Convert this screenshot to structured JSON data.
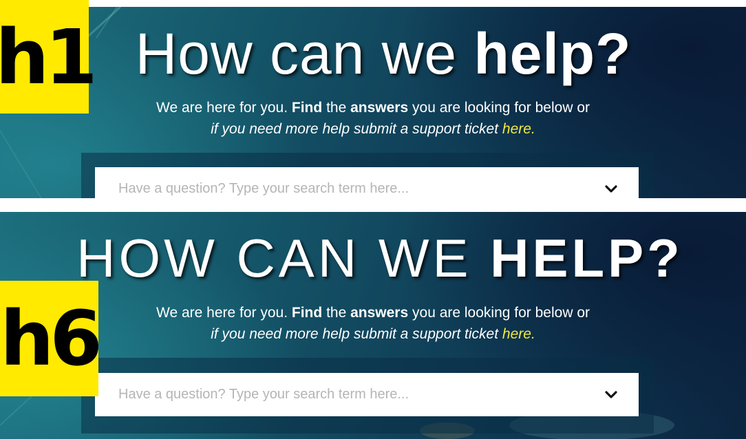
{
  "top_panel": {
    "heading_level_tag": "h1",
    "headline_light": "How can we",
    "headline_bold": "help?",
    "subtitle": {
      "part1": "We are here for you.",
      "find": "Find",
      "the": "the",
      "answers": "answers",
      "rest": "you are looking for below or",
      "line2": "if you need more help submit a support ticket",
      "link": "here."
    },
    "search": {
      "placeholder": "Have a question? Type your search term here..."
    }
  },
  "bottom_panel": {
    "heading_level_tag": "h6",
    "headline_light": "HOW CAN WE",
    "headline_bold": "HELP?",
    "subtitle": {
      "part1": "We are here for you.",
      "find": "Find",
      "the": "the",
      "answers": "answers",
      "rest": "you are looking for below or",
      "line2": "if you need more help submit a support ticket",
      "link": "here."
    },
    "search": {
      "placeholder": "Have a question? Type your search term here..."
    }
  },
  "colors": {
    "label_tag": "#ffea00",
    "link": "#f2ea3f",
    "background_dark": "#0c2541",
    "background_teal": "#1d6f7e"
  },
  "icons": {
    "dropdown": "chevron-down-icon"
  }
}
